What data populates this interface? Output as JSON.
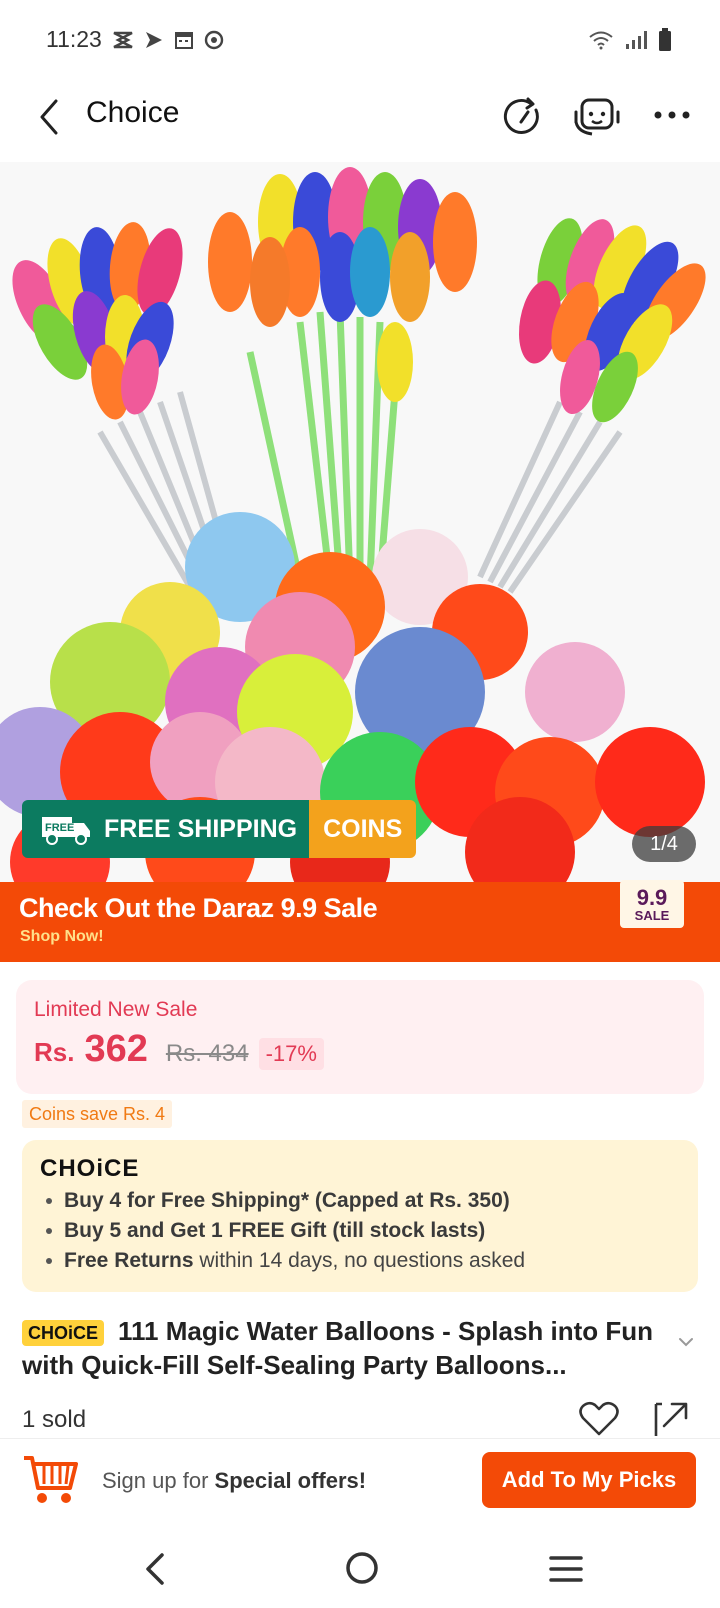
{
  "status": {
    "time": "11:23",
    "icons_left": [
      "capcut-icon",
      "send-icon",
      "calendar-icon",
      "chrome-icon"
    ],
    "icons_right": [
      "wifi-icon",
      "signal-icon",
      "battery-icon"
    ]
  },
  "header": {
    "title": "Choice"
  },
  "gallery": {
    "counter": "1/4",
    "shipping_label": "FREE SHIPPING",
    "free_tag": "FREE",
    "coins_label": "COINS"
  },
  "sale_banner": {
    "title": "Check Out the  Daraz 9.9 Sale",
    "subtitle": "Shop Now!",
    "badge_number": "9.9",
    "badge_word": "SALE"
  },
  "price": {
    "label": "Limited New Sale",
    "currency": "Rs.",
    "current": "362",
    "original": "Rs. 434",
    "discount": "-17%",
    "coins_save": "Coins save Rs. 4"
  },
  "choice": {
    "logo": "CHOiCE",
    "benefits": [
      {
        "bold": "Buy 4 for  Free Shipping* (Capped at Rs. 350)",
        "rest": ""
      },
      {
        "bold": "Buy 5 and Get 1 FREE Gift (till stock lasts)",
        "rest": ""
      },
      {
        "bold": "Free Returns",
        "rest": " within 14 days, no questions asked"
      }
    ]
  },
  "product": {
    "tag": "CHOiCE",
    "title": "111 Magic Water Balloons - Splash into Fun with Quick-Fill Self-Sealing Party Balloons...",
    "sold": "1 sold"
  },
  "bottom_bar": {
    "signup_prefix": "Sign up for ",
    "signup_bold": "Special offers!",
    "picks_button": "Add To My Picks"
  },
  "colors": {
    "brand_orange": "#f34a07",
    "price_red": "#e23a54",
    "shipping_green": "#0c7b60",
    "coins_yellow": "#f3a21c",
    "choice_yellow": "#ffd13b"
  }
}
